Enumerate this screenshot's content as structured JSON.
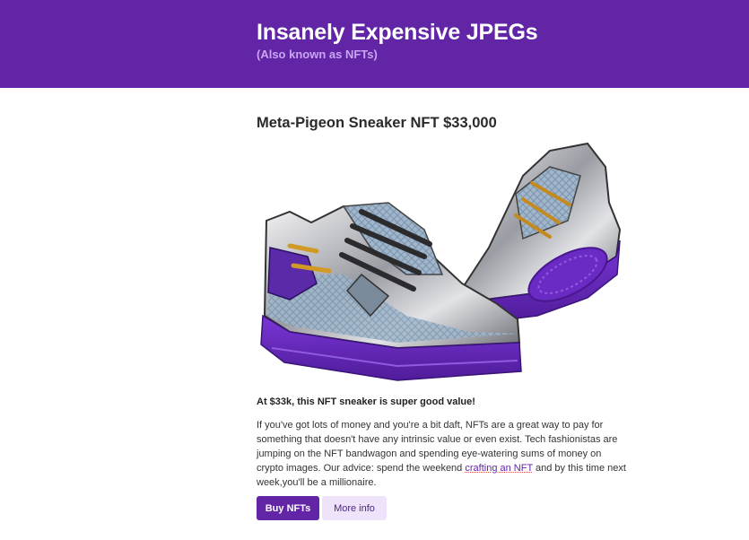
{
  "header": {
    "title": "Insanely Expensive JPEGs",
    "subtitle": "(Also known as NFTs)"
  },
  "product": {
    "title": "Meta-Pigeon Sneaker NFT $33,000",
    "tagline": "At $33k, this NFT sneaker is super good value!",
    "description_before_link": "If you've got lots of money and you're a bit daft, NFTs are a great way to pay for something that doesn't have any intrinsic value or even exist. Tech fashionistas are jumping on the NFT bandwagon and spending eye-watering sums of money on crypto images. Our advice: spend the weekend ",
    "description_link": "crafting an NFT",
    "description_after_link": " and by this time next week,you'll be a millionaire.",
    "image_icon": "sneaker-icon"
  },
  "actions": {
    "buy_label": "Buy NFTs",
    "info_label": "More info"
  },
  "colors": {
    "brand": "#6125a6",
    "subtitle": "#c9a6f2",
    "secondary_button_bg": "#efe2fb",
    "sole": "#6a28c2"
  }
}
